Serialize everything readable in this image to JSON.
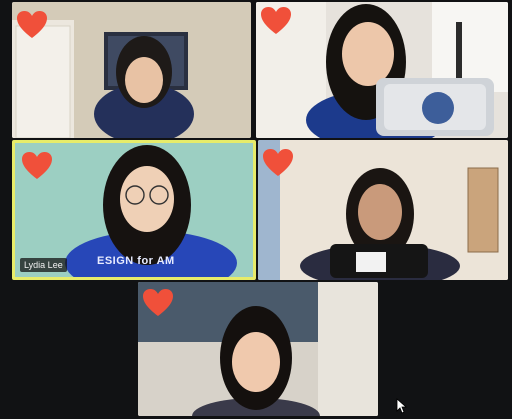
{
  "app": {
    "view": "gallery"
  },
  "participants": [
    {
      "id": "p1",
      "name": ""
    },
    {
      "id": "p2",
      "name": ""
    },
    {
      "id": "p3",
      "name": "Lydia Lee",
      "shirt_text": "ESIGN for AM",
      "active_speaker": true
    },
    {
      "id": "p4",
      "name": ""
    },
    {
      "id": "p5",
      "name": ""
    }
  ],
  "reactions": {
    "icon": "heart-icon",
    "color": "#f0503a"
  },
  "colors": {
    "active_border": "#e7ec6a",
    "background": "#111214"
  }
}
